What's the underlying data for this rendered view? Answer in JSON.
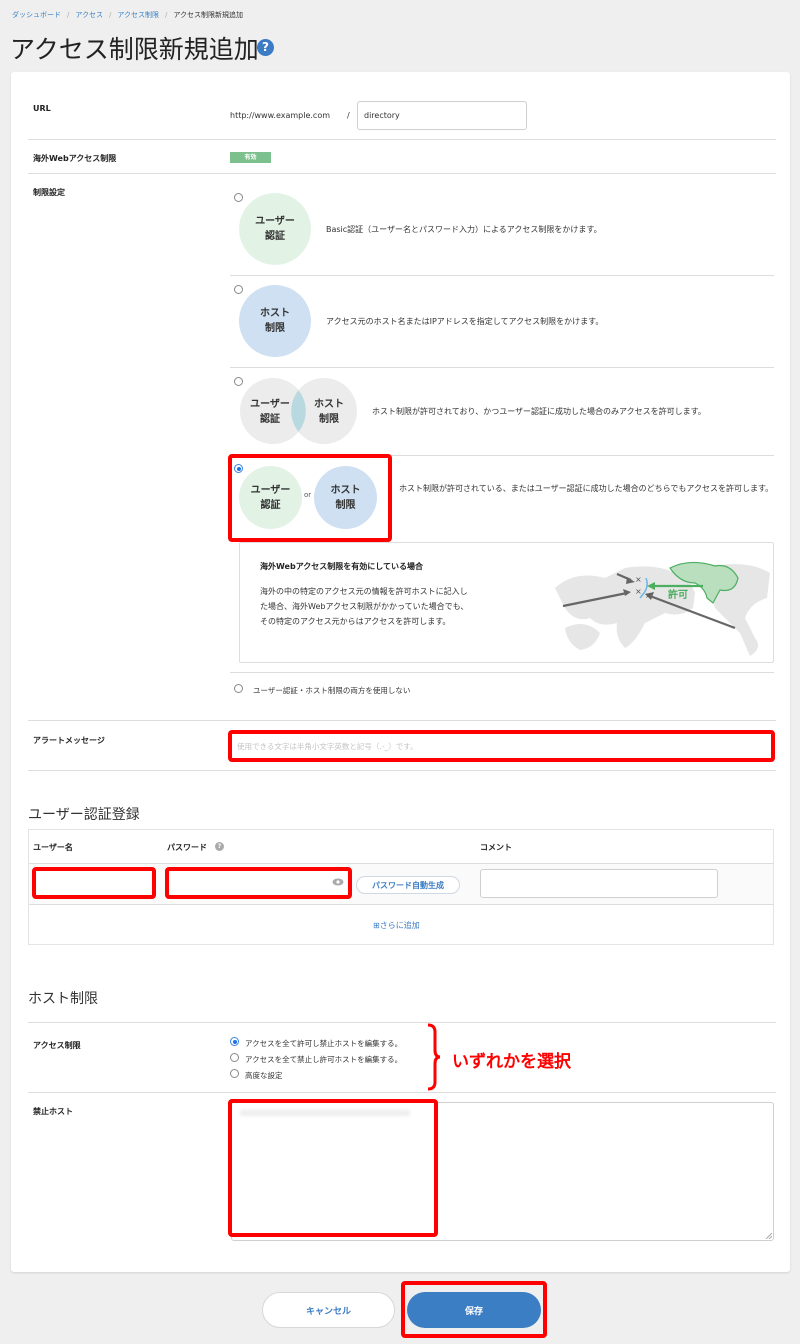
{
  "breadcrumb": [
    {
      "label": "ダッシュボード",
      "link": true
    },
    {
      "label": "アクセス",
      "link": true
    },
    {
      "label": "アクセス制限",
      "link": true
    },
    {
      "label": "アクセス制限新規追加",
      "link": false
    }
  ],
  "page_title": "アクセス制限新規追加",
  "help_icon_glyph": "?",
  "form": {
    "url": {
      "label": "URL",
      "domain": "http://www.example.com",
      "separator": "/",
      "directory_value": "directory"
    },
    "overseas": {
      "label": "海外Webアクセス制限",
      "badge": "有効",
      "badge_color": "#7cc08d"
    },
    "restriction": {
      "label": "制限設定",
      "options": [
        {
          "circles": [
            "ユーザー\n認証"
          ],
          "description": "Basic認証（ユーザー名とパスワード入力）によるアクセス制限をかけます。",
          "selected": false
        },
        {
          "circles": [
            "ホスト\n制限"
          ],
          "description": "アクセス元のホスト名またはIPアドレスを指定してアクセス制限をかけます。",
          "selected": false
        },
        {
          "circles": [
            "ユーザー\n認証",
            "ホスト\n制限"
          ],
          "description": "ホスト制限が許可されており、かつユーザー認証に成功した場合のみアクセスを許可します。",
          "selected": false
        },
        {
          "circles": [
            "ユーザー\n認証",
            "ホスト\n制限"
          ],
          "connector": "or",
          "description": "ホスト制限が許可されている、またはユーザー認証に成功した場合のどちらでもアクセスを許可します。",
          "selected": true
        },
        {
          "label": "ユーザー認証・ホスト制限の両方を使用しない",
          "selected": false
        }
      ],
      "info": {
        "title": "海外Webアクセス制限を有効にしている場合",
        "body": "海外の中の特定のアクセス元の情報を許可ホストに記入した場合、海外Webアクセス制限がかかっていた場合でも、その特定のアクセス元からはアクセスを許可します。",
        "map_label": "許可"
      }
    },
    "alert": {
      "label": "アラートメッセージ",
      "placeholder": "使用できる文字は半角小文字英数と記号（.-_）です。",
      "value": ""
    }
  },
  "user_auth": {
    "title": "ユーザー認証登録",
    "columns": [
      "ユーザー名",
      "パスワード",
      "コメント"
    ],
    "rows": [
      {
        "username": "",
        "password": "",
        "comment": ""
      }
    ],
    "generate_password_label": "パスワード自動生成",
    "add_more_label": "⊞さらに追加"
  },
  "host_restriction": {
    "title": "ホスト制限",
    "access_label": "アクセス制限",
    "options": [
      {
        "label": "アクセスを全て許可し禁止ホストを編集する。",
        "selected": true
      },
      {
        "label": "アクセスを全て禁止し許可ホストを編集する。",
        "selected": false
      },
      {
        "label": "高度な設定",
        "selected": false
      }
    ],
    "blocked_label": "禁止ホスト",
    "blocked_value": ""
  },
  "annotation": {
    "choose_one": "いずれかを選択",
    "color": "#ff0000"
  },
  "buttons": {
    "cancel": "キャンセル",
    "save": "保存"
  }
}
